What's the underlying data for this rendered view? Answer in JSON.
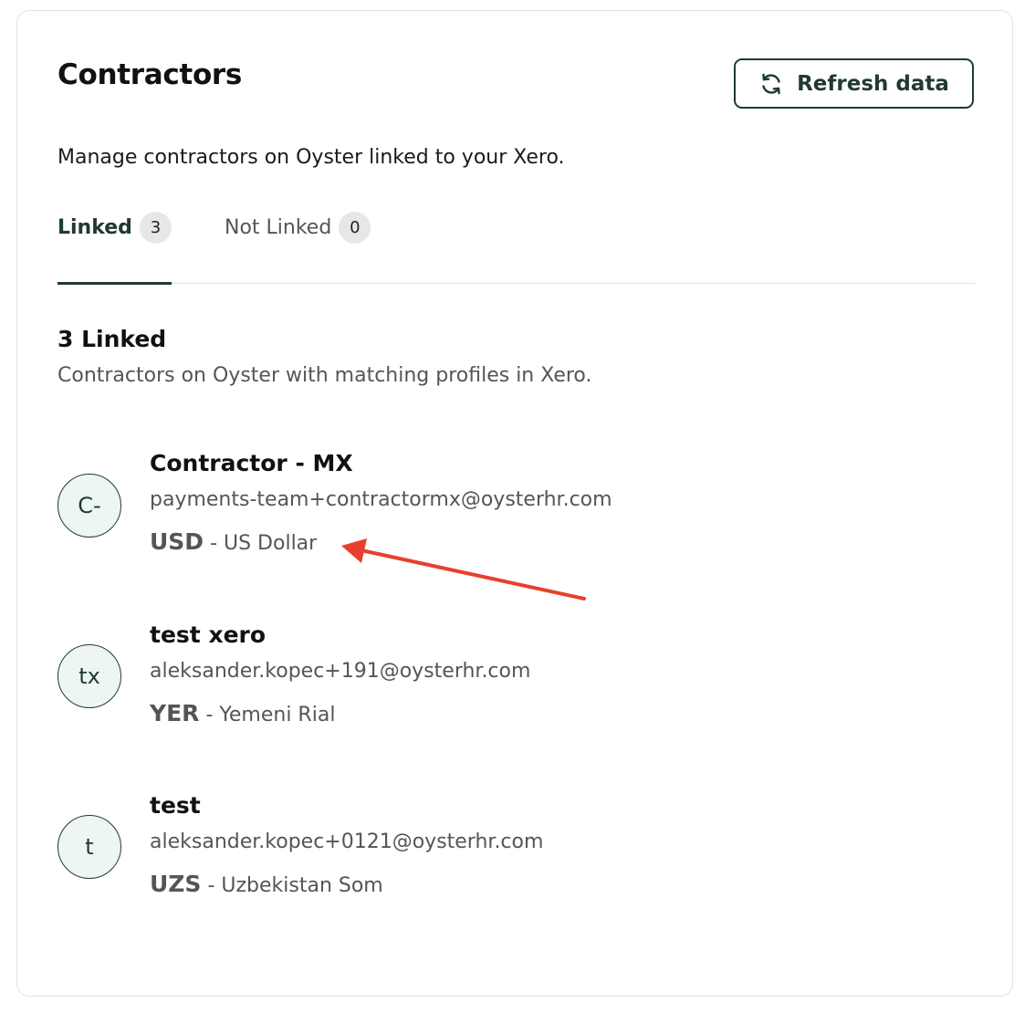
{
  "header": {
    "title": "Contractors",
    "refresh_label": "Refresh data",
    "subtitle": "Manage contractors on Oyster linked to your Xero."
  },
  "tabs": [
    {
      "label": "Linked",
      "count": "3",
      "active": true
    },
    {
      "label": "Not Linked",
      "count": "0",
      "active": false
    }
  ],
  "section": {
    "title": "3 Linked",
    "description": "Contractors on Oyster with matching profiles in Xero."
  },
  "contractors": [
    {
      "initials": "C-",
      "name": "Contractor - MX",
      "email": "payments-team+contractormx@oysterhr.com",
      "currency_code": "USD",
      "currency_name": "- US Dollar"
    },
    {
      "initials": "tx",
      "name": "test xero",
      "email": "aleksander.kopec+191@oysterhr.com",
      "currency_code": "YER",
      "currency_name": "- Yemeni Rial"
    },
    {
      "initials": "t",
      "name": "test",
      "email": "aleksander.kopec+0121@oysterhr.com",
      "currency_code": "UZS",
      "currency_name": "- Uzbekistan Som"
    }
  ],
  "colors": {
    "brand_dark_green": "#1f3a32",
    "avatar_bg": "#eef6f2",
    "annotation_arrow": "#e8402c",
    "muted_text": "#555555"
  },
  "icons": {
    "refresh": "refresh-icon",
    "annotation": "annotation-arrow"
  }
}
